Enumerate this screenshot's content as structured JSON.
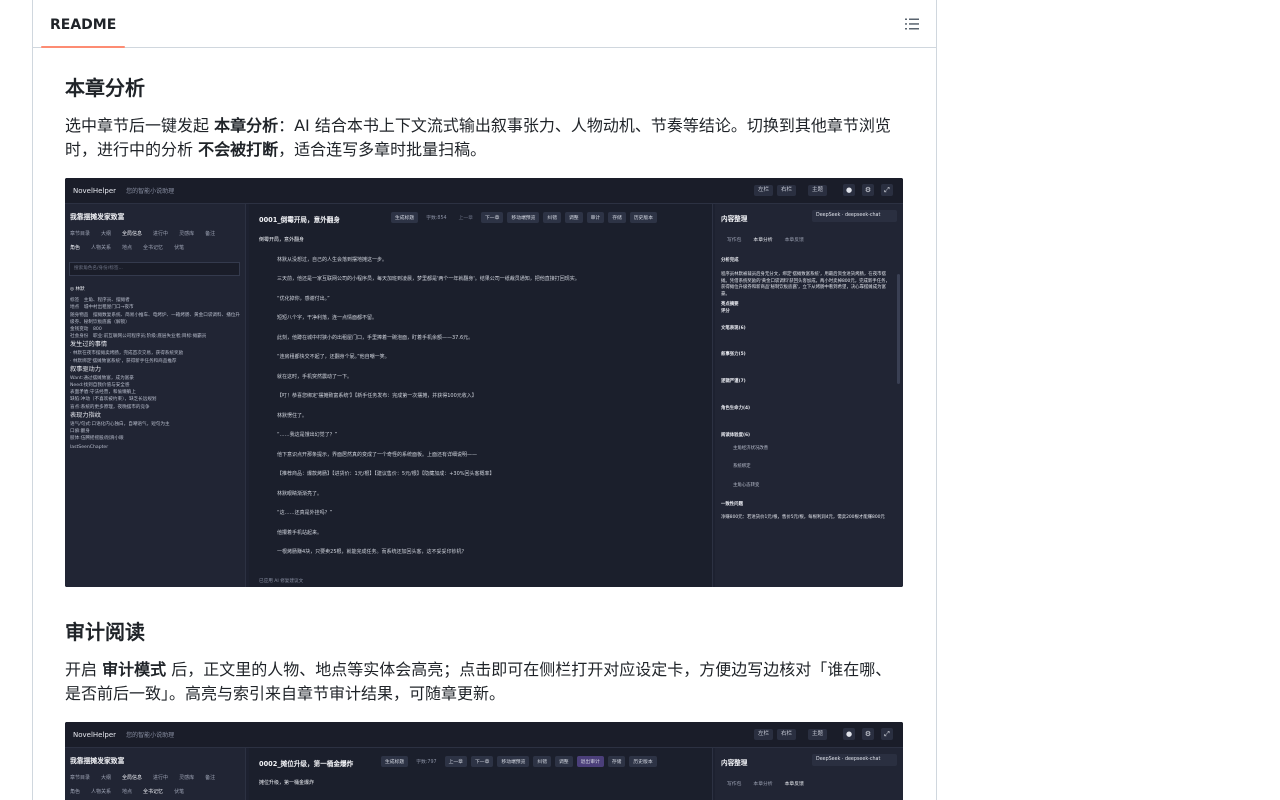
{
  "readme": {
    "tab_label": "README",
    "toc_icon": "list-unordered-icon",
    "accent": "#fd8c73"
  },
  "sections": [
    {
      "heading": "本章分析",
      "text_parts": [
        "选中章节后一键发起 ",
        "本章分析",
        "：AI 结合本书上下文流式输出叙事张力、人物动机、节奏等结论。切换到其他章节浏览时，进行中的分析 ",
        "不会被打断",
        "，适合连写多章时批量扫稿。"
      ],
      "screenshot": {
        "brand": "NovelHelper",
        "brand_sub": "您的智能小说助理",
        "topbar_buttons": [
          "左栏",
          "右栏",
          "主题"
        ],
        "book_title": "我靠摆摊发家致富",
        "left_tabs": [
          "章节目录",
          "大纲",
          "全局信息",
          "进行中",
          "灵感库",
          "备注"
        ],
        "left_subtabs": [
          "角色",
          "人物关系",
          "地点",
          "全书记忆",
          "伏笔"
        ],
        "search_placeholder": "搜索角色名/身份/标签...",
        "left_lines": [
          "◎ 林默",
          "标签　主角、程序员、摆摊者",
          "地点　城中村出租屋门口→夜市",
          "随身物品　摆摊数复系统、简易小推车、电烤炉、一箱烤肠、黄金口袋调料、播位升级券、秘制饮板底酱（解锁）",
          "金钱变动　800",
          "社会身份　职业:前互联网公司程序员;阶级:底层失业者;目标:摊霸员",
          "发生过的事情",
          "· 林默在夜市摆摊卖烤肠，完成首次交易，获得系统奖励",
          "· 林默绑定'摆摊致富系统'，获得新手任务和商品推荐",
          "叙事驱动力",
          "Want:通过摆摊致富，成为富豪",
          "Need:找到自我价值与安全感",
          "表面矛盾:守法经营，和偷懒躺上",
          "缺陷:冲动（不喜欢被约束），缺乏长远规划",
          "盲点:系统的更多原理，夜晚摆市的竞争",
          "表现力指纹",
          "语气/句式:口语化内心独白，自嘲语气，短句为主",
          "口癖:翻身",
          "肢体:伍腾摇摇股/削滑小眼",
          "lastSeenChapter"
        ],
        "chapter_title": "0001_倒霉开局，意外翻身",
        "word_count": "字数:854",
        "editor_buttons": [
          "生成标题",
          "上一章",
          "下一章",
          "移动端预览",
          "纠错",
          "调整",
          "审计",
          "存储",
          "历史版本"
        ],
        "editor_lines": [
          "倒霉开局，意外翻身",
          "林默从没想过，自己的人生会落到摆地摊这一步。",
          "三天前，他还是一家互联网公司的小程序员，每天加班到凌晨，梦里都是'两个一年就翻身'。结果公司一纸裁员通知，把他直接打回现实。",
          "“优化掉你，感谢付出。”",
          "短短八个字，干净利落，连一点情面都不留。",
          "此刻，他蹲在城中村狭小的出租屋门口，手里捧着一碗泡面，盯着手机余额——37.6元。",
          "“连房租都快交不起了，还翻身个屁。”他自嘲一笑。",
          "就在这时，手机突然震动了一下。",
          "【叮！恭喜您绑定'摆摊致富系统'】【新手任务发布：完成第一次摆摊，并获得100元收入】",
          "林默愣住了。",
          "“……我这是饿出幻觉了？”",
          "他下意识点开那条提示，界面居然真的变成了一个奇怪的系统面板。上面还有详细说明——",
          "【推荐商品：爆款烤肠】【进货价：1元/根】【建议售价：5元/根】【隐藏加成：+30%回头客概率】",
          "林默眼睛渐渐亮了。",
          "“这……还真是外挂吗？”",
          "他攥着手机站起来。",
          "一根烤肠赚4块，只要卖25根，就能完成任务。而系统还加回头客，这不妥妥印钞机？"
        ],
        "editor_footer": "已应用 AI 修复建议文",
        "right_title": "内容整理",
        "model_select": "DeepSeek · deepseek-chat",
        "right_tabs": [
          "写作包",
          "本章分析",
          "本章反馈"
        ],
        "right_lines": [
          "分析完成",
          "程序员林默被裁员后身无分文，绑定'摆摊致富系统'，用最后资金进货烤肠，在夜市摆摊。凭借系统奖励的'黄金口袋调料'获回头客加成，两小时卖掉800元，完成新手任务，获得摊位升级券和新商品'秘制饮板底酱'，立下从烤肠中看到希望，决心靠摆摊成为富豪。",
          "亮点摘要",
          "评分",
          "文笔表现(6)",
          "叙事张力(5)",
          "逻辑严谨(7)",
          "角色生命力(4)",
          "阅读体验度(6)",
          "主角经济状况改善",
          "系统绑定",
          "主角心态转变",
          "一致性问题",
          "净赚800元：若进货价1元/根，售价5元/根，每根利润4元，需卖200根才能赚800元"
        ]
      }
    },
    {
      "heading": "审计阅读",
      "text_parts": [
        "开启 ",
        "审计模式",
        " 后，正文里的人物、地点等实体会高亮；点击即可在侧栏打开对应设定卡，方便边写边核对「谁在哪、是否前后一致」。高亮与索引来自章节审计结果，可随章更新。"
      ],
      "screenshot": {
        "brand": "NovelHelper",
        "brand_sub": "您的智能小说助理",
        "book_title": "我靠摆摊发家致富",
        "left_tabs": [
          "章节目录",
          "大纲",
          "全局信息",
          "进行中",
          "灵感库",
          "备注"
        ],
        "left_subtabs": [
          "角色",
          "人物关系",
          "地点",
          "全书记忆",
          "伏笔"
        ],
        "chapter_title": "0002_摊位升级，第一桶金爆炸",
        "word_count": "字数:797",
        "editor_buttons": [
          "生成标题",
          "上一章",
          "下一章",
          "移动端预览",
          "纠错",
          "调整",
          "退出审计",
          "存储",
          "历史版本"
        ],
        "editor_first_line": "摊位升级，第一桶金爆炸",
        "right_title": "内容整理",
        "model_select": "DeepSeek · deepseek-chat",
        "right_tabs": [
          "写作包",
          "本章分析",
          "本章反馈"
        ]
      }
    }
  ]
}
